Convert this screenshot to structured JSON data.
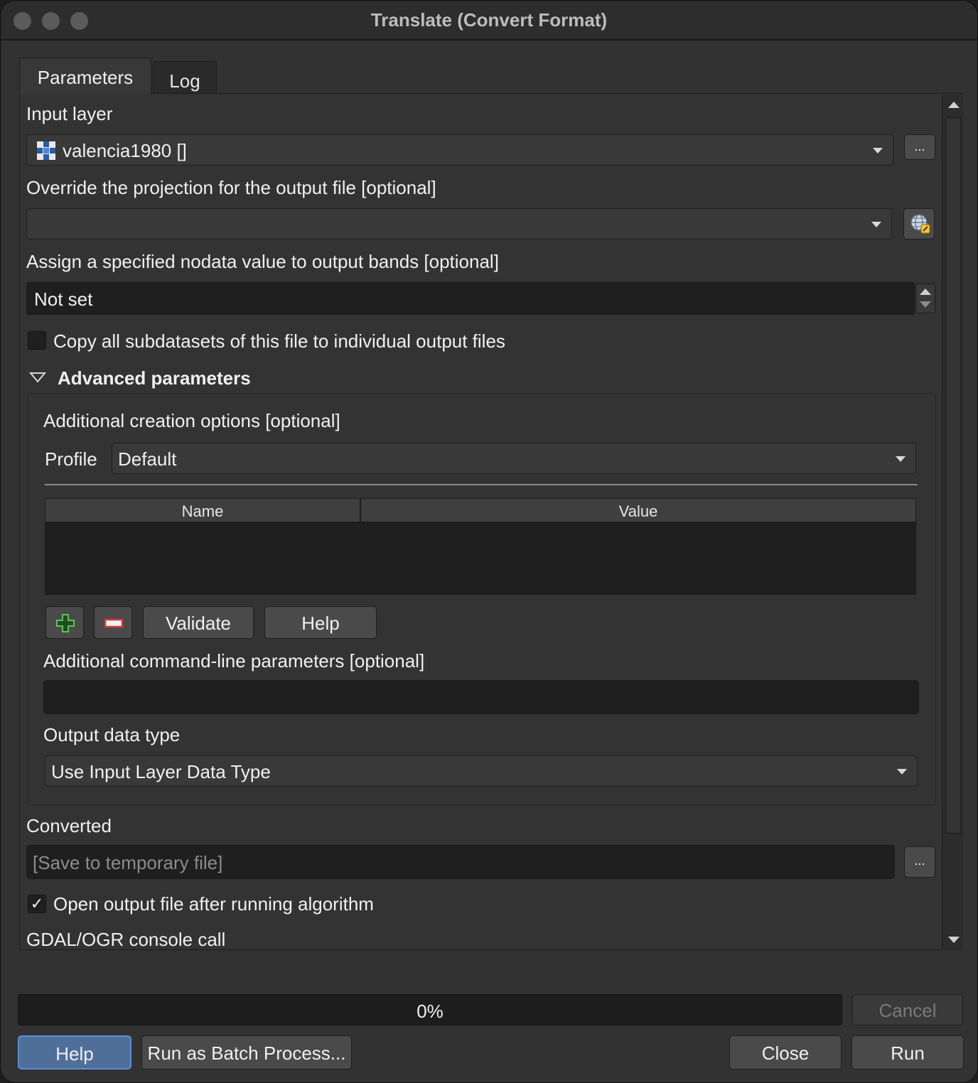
{
  "window": {
    "title": "Translate (Convert Format)"
  },
  "tabs": [
    {
      "label": "Parameters",
      "active": true
    },
    {
      "label": "Log",
      "active": false
    }
  ],
  "input_layer": {
    "label": "Input layer",
    "value": "valencia1980 []",
    "browse_label": "..."
  },
  "projection": {
    "label": "Override the projection for the output file [optional]",
    "value": ""
  },
  "nodata": {
    "label": "Assign a specified nodata value to output bands [optional]",
    "value": "Not set"
  },
  "copy_subdatasets": {
    "label": "Copy all subdatasets of this file to individual output files",
    "checked": false
  },
  "advanced": {
    "label": "Advanced parameters",
    "expanded": true,
    "creation_options": {
      "label": "Additional creation options [optional]",
      "profile_label": "Profile",
      "profile_value": "Default",
      "table_headers": [
        "Name",
        "Value"
      ],
      "rows": [],
      "validate_label": "Validate",
      "help_label": "Help"
    },
    "cmdline": {
      "label": "Additional command-line parameters [optional]",
      "value": ""
    },
    "output_type": {
      "label": "Output data type",
      "value": "Use Input Layer Data Type"
    }
  },
  "converted": {
    "label": "Converted",
    "placeholder": "[Save to temporary file]",
    "browse_label": "..."
  },
  "open_output": {
    "label": "Open output file after running algorithm",
    "checked": true,
    "check_glyph": "✓"
  },
  "console_call": {
    "label": "GDAL/OGR console call"
  },
  "progress": {
    "value": 0,
    "text": "0%"
  },
  "buttons": {
    "cancel": "Cancel",
    "help": "Help",
    "batch": "Run as Batch Process...",
    "close": "Close",
    "run": "Run"
  },
  "colors": {
    "window_bg": "#323232",
    "field_dark": "#1f1f1f",
    "accent_focus": "#5b8fd1",
    "add_green": "#3fa33f",
    "remove_red": "#d03a3a"
  }
}
